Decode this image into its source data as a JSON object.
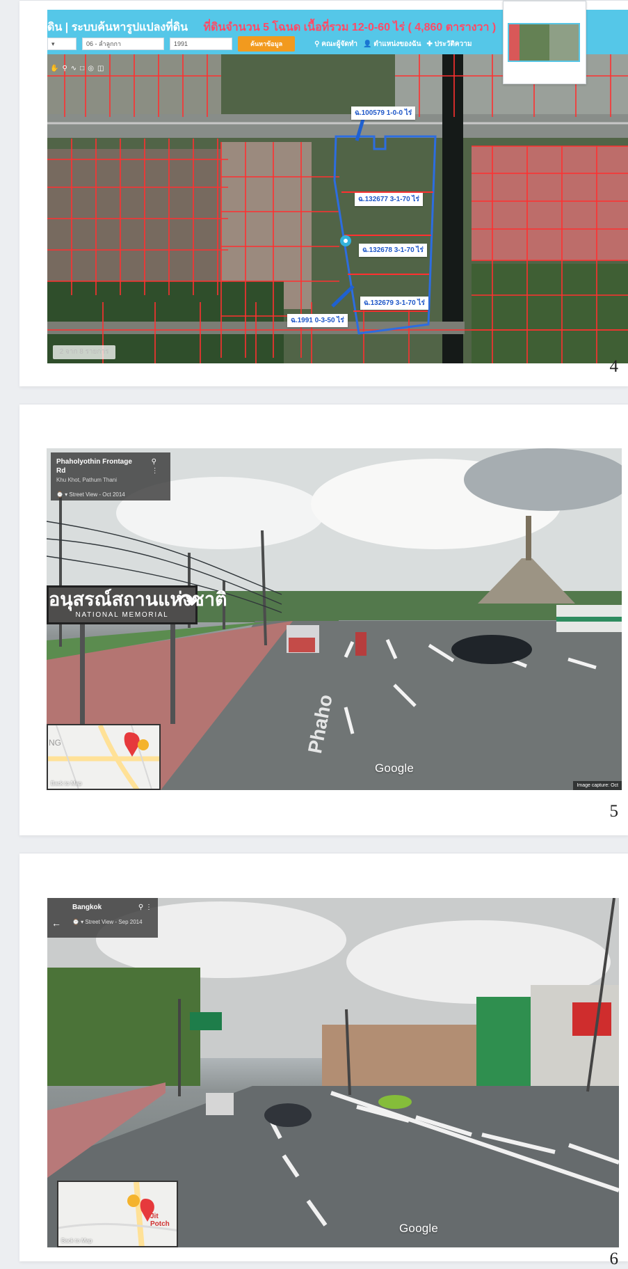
{
  "pages": [
    {
      "number": "4",
      "map": {
        "title_left": "ดิน | ระบบค้นหารูปแปลงที่ดิน",
        "title_right": "ที่ดินจำนวน 5 โฉนด เนื้อที่รวม 12-0-60 ไร่ ( 4,860 ตารางวา )",
        "select_one": "▾",
        "select_two": "06 - ลำลูกกา",
        "input_value": "1991",
        "search_button": "ค้นหาข้อมูล",
        "links": [
          "คณะผู้จัดทำ",
          "ตำแหน่งของฉัน",
          "ประวัติความ"
        ],
        "tools": [
          "✋",
          "⚲",
          "∿",
          "□",
          "◎",
          "◫"
        ],
        "parcel_labels": [
          "ฉ.100579 1-0-0 ไร่",
          "ฉ.132677 3-1-70 ไร่",
          "ฉ.132678 3-1-70 ไร่",
          "ฉ.132679 3-1-70 ไร่",
          "ฉ.1991 0-3-50 ไร่"
        ],
        "scale_text": "2 จาก 8 รายการ"
      }
    },
    {
      "number": "5",
      "street_view": {
        "title": "Phaholyothin Frontage Rd",
        "subtitle": "Khu Khot, Pathum Thani",
        "date": "Street View - Oct 2014",
        "sign_thai": "อนุสรณ์สถานแห่งชาติ",
        "sign_english": "NATIONAL MEMORIAL",
        "road_text": "Phaho",
        "mini_map_text": "NG",
        "mini_map_label": "Back to Map",
        "google": "Google",
        "capture": "Image capture: Oct"
      }
    },
    {
      "number": "6",
      "street_view": {
        "title": "Bangkok",
        "date": "Street View - Sep 2014",
        "mini_map_text": "Jit Potch",
        "mini_map_label": "Back to Map",
        "google": "Google"
      }
    }
  ],
  "colors": {
    "header": "#55c7e8",
    "accent": "#ff4a66",
    "button": "#f29a1e",
    "parcel_blue": "#1e57c8"
  }
}
